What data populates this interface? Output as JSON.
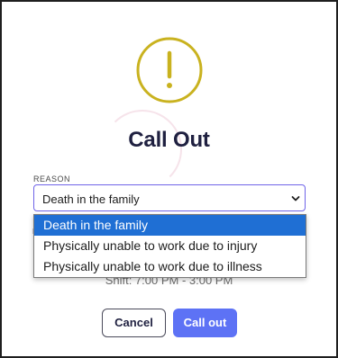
{
  "dialog": {
    "title": "Call Out",
    "icon": "exclamation-circle-icon",
    "accent_color": "#c9b21f"
  },
  "reason": {
    "label": "REASON",
    "selected": "Death in the family",
    "options": [
      "Death in the family",
      "Physically unable to work due to injury",
      "Physically unable to work due to illness"
    ],
    "highlight_color": "#1f6fd4"
  },
  "shift": {
    "text": "Shift: 7:00 PM - 3:00 PM"
  },
  "actions": {
    "cancel_label": "Cancel",
    "callout_label": "Call out",
    "primary_color": "#5d72f5"
  }
}
